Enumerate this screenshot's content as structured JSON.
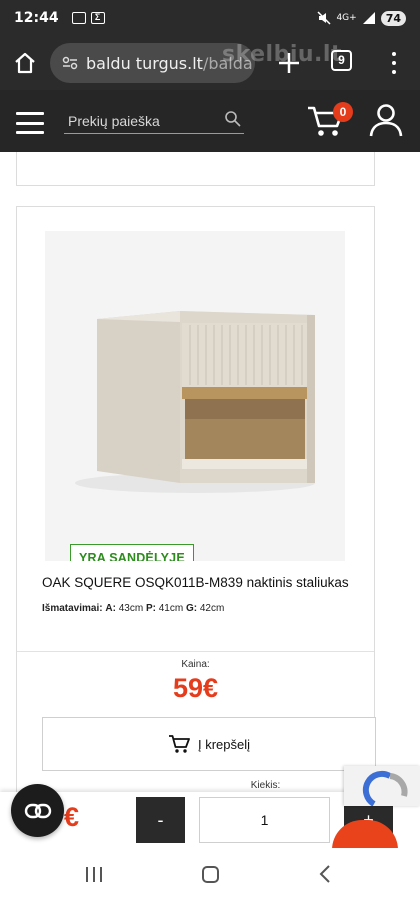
{
  "status_bar": {
    "time": "12:44",
    "network": "4G+",
    "battery": "74",
    "left_icons": [
      "screenshot-icon",
      "sigma-icon"
    ],
    "right_icons": [
      "mute-icon",
      "mobile-data-icon",
      "signal-icon",
      "battery-icon"
    ]
  },
  "browser": {
    "url_host": "baldu turgus.lt",
    "url_path": "/balda",
    "watermark": "skelbiu.lt",
    "tabs_count": "9"
  },
  "site_header": {
    "search_placeholder": "Prekių paieška",
    "cart_count": "0"
  },
  "product": {
    "stock_badge": "YRA SANDĖLYJE",
    "title": "OAK SQUERE OSQK011B-M839 naktinis staliukas",
    "dims_label": "Išmatavimai:",
    "dims": [
      {
        "key": "A:",
        "value": "43cm"
      },
      {
        "key": "P:",
        "value": "41cm"
      },
      {
        "key": "G:",
        "value": "42cm"
      }
    ],
    "price_label": "Kaina:",
    "price": "59€",
    "add_to_cart_label": "Į krepšelį",
    "quantity_label": "Kiekis:"
  },
  "sticky_bar": {
    "price": "€",
    "minus_label": "-",
    "quantity_value": "1",
    "plus_label": "+"
  },
  "colors": {
    "price_red": "#e53c1c",
    "stock_green": "#2d8c1e",
    "header_dark": "#262626"
  }
}
